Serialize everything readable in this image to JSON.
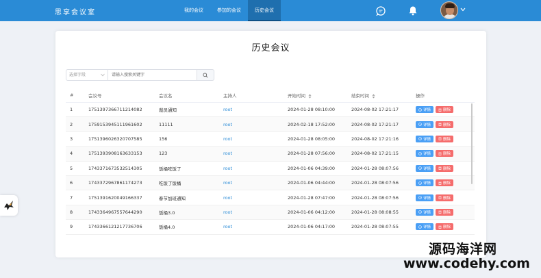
{
  "app": {
    "brand": "思享会议室"
  },
  "nav": {
    "items": [
      "我的会议",
      "参加的会议",
      "历史会议"
    ],
    "active_index": 2
  },
  "page": {
    "title": "历史会议"
  },
  "search": {
    "field_placeholder": "选择字段",
    "keyword_placeholder": "请输入搜索关键字"
  },
  "table": {
    "headers": [
      "#",
      "会议号",
      "会议名",
      "主持人",
      "开始时间",
      "结束时间",
      "操作"
    ],
    "detail_label": "详情",
    "delete_label": "删除",
    "rows": [
      {
        "idx": "1",
        "id": "1751397366711214082",
        "name": "裁员通知",
        "host": "root",
        "start": "2024-01-28 08:10:00",
        "end": "2024-08-02 17:21:17"
      },
      {
        "idx": "2",
        "id": "1759153945111961602",
        "name": "11111",
        "host": "root",
        "start": "2024-02-18 17:52:00",
        "end": "2024-08-02 17:21:17"
      },
      {
        "idx": "3",
        "id": "1751396026320707585",
        "name": "156",
        "host": "root",
        "start": "2024-01-28 08:05:00",
        "end": "2024-08-02 17:21:16"
      },
      {
        "idx": "4",
        "id": "1751393908163633153",
        "name": "123",
        "host": "root",
        "start": "2024-01-28 07:56:00",
        "end": "2024-08-02 17:21:15"
      },
      {
        "idx": "5",
        "id": "1743371673532514305",
        "name": "饭桶吃饭了",
        "host": "root",
        "start": "2024-01-06 04:39:00",
        "end": "2024-01-28 08:07:56"
      },
      {
        "idx": "6",
        "id": "1743372967861174273",
        "name": "吃饭了饭桶",
        "host": "root",
        "start": "2024-01-06 04:44:00",
        "end": "2024-01-28 08:07:56"
      },
      {
        "idx": "7",
        "id": "1751391620049166337",
        "name": "春节加班通知",
        "host": "root",
        "start": "2024-01-28 07:47:00",
        "end": "2024-01-28 08:07:56"
      },
      {
        "idx": "8",
        "id": "1743364967557644290",
        "name": "饭桶3.0",
        "host": "root",
        "start": "2024-01-06 04:12:00",
        "end": "2024-01-28 08:08:55"
      },
      {
        "idx": "9",
        "id": "1743366121217736706",
        "name": "饭桶4.0",
        "host": "root",
        "start": "2024-01-06 04:17:00",
        "end": "2024-01-28 08:07:55"
      }
    ]
  },
  "watermark": {
    "line1": "源码海洋网",
    "line2": "www.codehy.com"
  },
  "icons": {
    "chat": "chat-icon",
    "bell": "bell-icon",
    "float": "bird-icon"
  },
  "colors": {
    "primary": "#2a8bd6",
    "detail": "#4a9ff5",
    "delete": "#f56c6c"
  }
}
